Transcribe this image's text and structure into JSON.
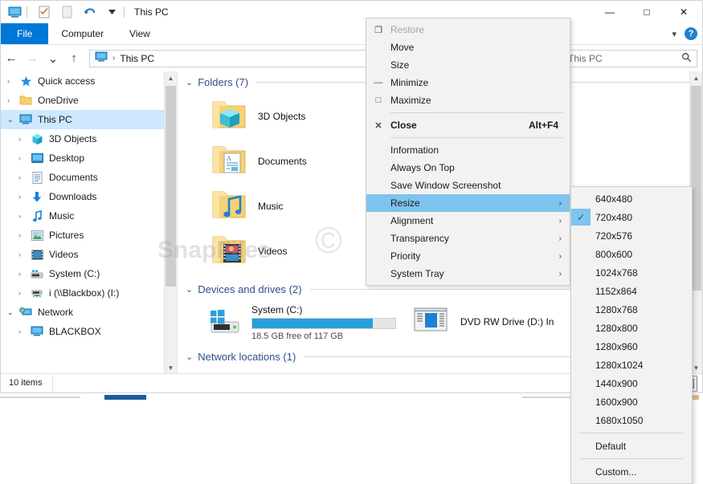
{
  "window": {
    "title": "This PC",
    "quick_access_icons": [
      "monitor-icon",
      "properties-icon",
      "new-folder-icon",
      "undo-icon",
      "customize-dropdown-icon"
    ],
    "controls": {
      "minimize": "—",
      "maximize": "□",
      "close": "✕"
    }
  },
  "ribbon": {
    "tabs": [
      {
        "label": "File",
        "active": true
      },
      {
        "label": "Computer",
        "active": false
      },
      {
        "label": "View",
        "active": false
      }
    ],
    "collapse_icon": "chevron-down-icon",
    "help_label": "?"
  },
  "address_bar": {
    "back_icon": "←",
    "forward_icon": "→",
    "recent_icon": "⌄",
    "up_icon": "↑",
    "breadcrumb_icon": "this-pc-icon",
    "breadcrumb_separator": "›",
    "breadcrumb_text": "This PC",
    "search_placeholder": "This PC",
    "search_icon": "search-icon"
  },
  "sidebar": {
    "items": [
      {
        "label": "Quick access",
        "icon": "star-icon",
        "arrow": "›",
        "indent": 0,
        "selected": false
      },
      {
        "label": "OneDrive",
        "icon": "onedrive-folder-icon",
        "arrow": "›",
        "indent": 0,
        "selected": false
      },
      {
        "label": "This PC",
        "icon": "this-pc-icon",
        "arrow": "⌄",
        "indent": 0,
        "selected": true
      },
      {
        "label": "3D Objects",
        "icon": "3d-objects-icon",
        "arrow": "›",
        "indent": 1,
        "selected": false
      },
      {
        "label": "Desktop",
        "icon": "desktop-icon",
        "arrow": "›",
        "indent": 1,
        "selected": false
      },
      {
        "label": "Documents",
        "icon": "documents-icon",
        "arrow": "›",
        "indent": 1,
        "selected": false
      },
      {
        "label": "Downloads",
        "icon": "downloads-icon",
        "arrow": "›",
        "indent": 1,
        "selected": false
      },
      {
        "label": "Music",
        "icon": "music-icon",
        "arrow": "›",
        "indent": 1,
        "selected": false
      },
      {
        "label": "Pictures",
        "icon": "pictures-icon",
        "arrow": "›",
        "indent": 1,
        "selected": false
      },
      {
        "label": "Videos",
        "icon": "videos-icon",
        "arrow": "›",
        "indent": 1,
        "selected": false
      },
      {
        "label": "System (C:)",
        "icon": "hard-drive-icon",
        "arrow": "›",
        "indent": 1,
        "selected": false
      },
      {
        "label": "i (\\\\Blackbox) (I:)",
        "icon": "network-drive-icon",
        "arrow": "›",
        "indent": 1,
        "selected": false
      },
      {
        "label": "Network",
        "icon": "network-icon",
        "arrow": "⌄",
        "indent": 0,
        "selected": false
      },
      {
        "label": "BLACKBOX",
        "icon": "computer-icon",
        "arrow": "›",
        "indent": 1,
        "selected": false
      }
    ]
  },
  "content": {
    "folders_group": {
      "title": "Folders (7)",
      "chevron": "⌄",
      "items": [
        {
          "label": "3D Objects",
          "icon": "folder-3d-objects-icon"
        },
        {
          "label": "Documents",
          "icon": "folder-documents-icon"
        },
        {
          "label": "Music",
          "icon": "folder-music-icon"
        },
        {
          "label": "Videos",
          "icon": "folder-videos-icon"
        }
      ]
    },
    "devices_group": {
      "title": "Devices and drives (2)",
      "chevron": "⌄",
      "drives": [
        {
          "label": "System (C:)",
          "icon": "windows-drive-icon",
          "free_text": "18.5 GB free of 117 GB",
          "used_percent": 84,
          "bar_color": "#26a0da"
        },
        {
          "label": "DVD RW Drive (D:) In",
          "icon": "dvd-drive-icon",
          "free_text": "",
          "used_percent": 0,
          "bar_color": "#26a0da"
        }
      ]
    },
    "network_group": {
      "title": "Network locations (1)",
      "chevron": "⌄"
    }
  },
  "status_bar": {
    "item_count": "10 items",
    "view_buttons": [
      {
        "name": "details-view-icon",
        "active": false
      },
      {
        "name": "large-icons-view-icon",
        "active": true
      }
    ]
  },
  "context_menu": {
    "items": [
      {
        "label": "Restore",
        "glyph": "❐",
        "accel": "",
        "submenu": false,
        "disabled": true,
        "bold": false,
        "highlight": false,
        "separator_after": false
      },
      {
        "label": "Move",
        "glyph": "",
        "accel": "",
        "submenu": false,
        "disabled": false,
        "bold": false,
        "highlight": false,
        "separator_after": false
      },
      {
        "label": "Size",
        "glyph": "",
        "accel": "",
        "submenu": false,
        "disabled": false,
        "bold": false,
        "highlight": false,
        "separator_after": false
      },
      {
        "label": "Minimize",
        "glyph": "—",
        "accel": "",
        "submenu": false,
        "disabled": false,
        "bold": false,
        "highlight": false,
        "separator_after": false
      },
      {
        "label": "Maximize",
        "glyph": "□",
        "accel": "",
        "submenu": false,
        "disabled": false,
        "bold": false,
        "highlight": false,
        "separator_after": true
      },
      {
        "label": "Close",
        "glyph": "✕",
        "accel": "Alt+F4",
        "submenu": false,
        "disabled": false,
        "bold": true,
        "highlight": false,
        "separator_after": true
      },
      {
        "label": "Information",
        "glyph": "",
        "accel": "",
        "submenu": false,
        "disabled": false,
        "bold": false,
        "highlight": false,
        "separator_after": false
      },
      {
        "label": "Always On Top",
        "glyph": "",
        "accel": "",
        "submenu": false,
        "disabled": false,
        "bold": false,
        "highlight": false,
        "separator_after": false
      },
      {
        "label": "Save Window Screenshot",
        "glyph": "",
        "accel": "",
        "submenu": false,
        "disabled": false,
        "bold": false,
        "highlight": false,
        "separator_after": false
      },
      {
        "label": "Resize",
        "glyph": "",
        "accel": "",
        "submenu": true,
        "disabled": false,
        "bold": false,
        "highlight": true,
        "separator_after": false
      },
      {
        "label": "Alignment",
        "glyph": "",
        "accel": "",
        "submenu": true,
        "disabled": false,
        "bold": false,
        "highlight": false,
        "separator_after": false
      },
      {
        "label": "Transparency",
        "glyph": "",
        "accel": "",
        "submenu": true,
        "disabled": false,
        "bold": false,
        "highlight": false,
        "separator_after": false
      },
      {
        "label": "Priority",
        "glyph": "",
        "accel": "",
        "submenu": true,
        "disabled": false,
        "bold": false,
        "highlight": false,
        "separator_after": false
      },
      {
        "label": "System Tray",
        "glyph": "",
        "accel": "",
        "submenu": true,
        "disabled": false,
        "bold": false,
        "highlight": false,
        "separator_after": false
      }
    ]
  },
  "resize_submenu": {
    "items": [
      {
        "label": "640x480",
        "checked": false,
        "separator_after": false
      },
      {
        "label": "720x480",
        "checked": true,
        "separator_after": false
      },
      {
        "label": "720x576",
        "checked": false,
        "separator_after": false
      },
      {
        "label": "800x600",
        "checked": false,
        "separator_after": false
      },
      {
        "label": "1024x768",
        "checked": false,
        "separator_after": false
      },
      {
        "label": "1152x864",
        "checked": false,
        "separator_after": false
      },
      {
        "label": "1280x768",
        "checked": false,
        "separator_after": false
      },
      {
        "label": "1280x800",
        "checked": false,
        "separator_after": false
      },
      {
        "label": "1280x960",
        "checked": false,
        "separator_after": false
      },
      {
        "label": "1280x1024",
        "checked": false,
        "separator_after": false
      },
      {
        "label": "1440x900",
        "checked": false,
        "separator_after": false
      },
      {
        "label": "1600x900",
        "checked": false,
        "separator_after": false
      },
      {
        "label": "1680x1050",
        "checked": false,
        "separator_after": true
      },
      {
        "label": "Default",
        "checked": false,
        "separator_after": true
      },
      {
        "label": "Custom...",
        "checked": false,
        "separator_after": false
      }
    ],
    "check_glyph": "✓",
    "highlight_color": "#7fc3ef"
  },
  "watermark": {
    "text": "SnapFiles",
    "copyright": "©"
  }
}
